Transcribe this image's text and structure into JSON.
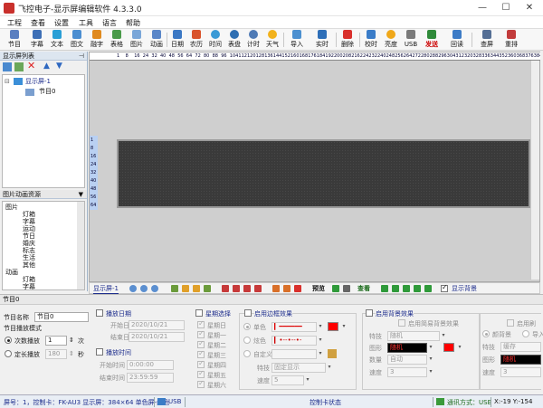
{
  "window": {
    "title": "飞控电子-显示屏编辑软件 4.3.3.0",
    "minimize": "—",
    "maximize": "☐",
    "close": "✕"
  },
  "menu": [
    "工程",
    "查看",
    "设置",
    "工具",
    "语言",
    "帮助"
  ],
  "toolbar": [
    "节目",
    "字幕",
    "文本",
    "图文",
    "融字",
    "表格",
    "图片",
    "动画",
    "日期",
    "农历",
    "时间",
    "表盘",
    "计时",
    "天气",
    "导入",
    "实时",
    "删除",
    "校时",
    "亮度",
    "USB",
    "发送",
    "回读",
    "查屏",
    "重排"
  ],
  "left_panel": {
    "title": "显示屏列表",
    "pin": "⊣",
    "tree": {
      "screen": "显示屏-1",
      "program": "节目0"
    },
    "resource_title": "图片动画资源",
    "resources": [
      {
        "label": "图片",
        "level": 0
      },
      {
        "label": "灯箱",
        "level": 1
      },
      {
        "label": "字幕",
        "level": 1
      },
      {
        "label": "运动",
        "level": 1
      },
      {
        "label": "节日",
        "level": 1
      },
      {
        "label": "婚庆",
        "level": 1
      },
      {
        "label": "标志",
        "level": 1
      },
      {
        "label": "生活",
        "level": 1
      },
      {
        "label": "其他",
        "level": 1
      },
      {
        "label": "动画",
        "level": 0
      },
      {
        "label": "灯箱",
        "level": 1
      },
      {
        "label": "字幕",
        "level": 1
      }
    ]
  },
  "ruler": {
    "h": [
      "1",
      "8",
      "16",
      "24",
      "32",
      "40",
      "48",
      "56",
      "64",
      "72",
      "80",
      "88",
      "96",
      "104",
      "112",
      "120",
      "128",
      "136",
      "144",
      "152",
      "160",
      "168",
      "176",
      "184",
      "192",
      "200",
      "208",
      "216",
      "224",
      "232",
      "240",
      "248",
      "256",
      "264",
      "272",
      "280",
      "288",
      "296",
      "304",
      "312",
      "320",
      "328",
      "336",
      "344",
      "352",
      "360",
      "368",
      "376",
      "384"
    ],
    "v": [
      "1",
      "8",
      "16",
      "24",
      "32",
      "40",
      "48",
      "56",
      "64"
    ]
  },
  "canvas_tools": {
    "screen": "显示屏-1",
    "preview": "预览",
    "view": "查看",
    "bg_label": "显示背景"
  },
  "program_panel": {
    "title": "节目0",
    "name_label": "节目名称",
    "name_value": "节目0",
    "mode_label": "节目播放模式",
    "count_label": "次数播放",
    "count_value": "1",
    "count_unit": "次",
    "time_label": "定长播放",
    "time_value": "180",
    "time_unit": "秒",
    "date": {
      "title": "播放日期",
      "start_label": "开始日期",
      "start": "2020/10/21",
      "end_label": "结束日期",
      "end": "2020/10/21"
    },
    "time": {
      "title": "播放时间",
      "start_label": "开始时间",
      "start": "0:00:00",
      "end_label": "结束时间",
      "end": "23:59:59"
    },
    "week": {
      "title": "星期选择",
      "days": [
        "星期日",
        "星期一",
        "星期二",
        "星期三",
        "星期四",
        "星期五",
        "星期六"
      ]
    },
    "border": {
      "title": "启用边框效果",
      "single": "单色",
      "color": "炫色",
      "custom": "自定义",
      "effect_label": "特技",
      "effect": "固定显示",
      "speed_label": "速度",
      "speed": "5",
      "swatch": "#ff0000"
    },
    "background": {
      "title": "启用背景效果",
      "simple": "启用简易背景效果",
      "effect_label": "特技",
      "effect": "随机",
      "shape_label": "图形",
      "shape": "随机",
      "count_label": "数量",
      "count": "自动",
      "speed_label": "速度",
      "speed": "3",
      "swatch": "#ff0000"
    },
    "right_group": {
      "title": "启用刷",
      "radio1": "颜背景",
      "radio2": "导入",
      "effect_label": "特技",
      "effect": "缓存",
      "shape_label": "图形",
      "shape": "随机",
      "speed_label": "速度",
      "speed": "3"
    }
  },
  "statusbar": {
    "screen_info": "屏号：1，控制卡：FK-AU3 显示屏：384×64 单色屏-红色",
    "port": "USB",
    "card_status": "控制卡状态",
    "comm": "通讯方式：USB",
    "coord": "X:-19 Y:-154"
  }
}
